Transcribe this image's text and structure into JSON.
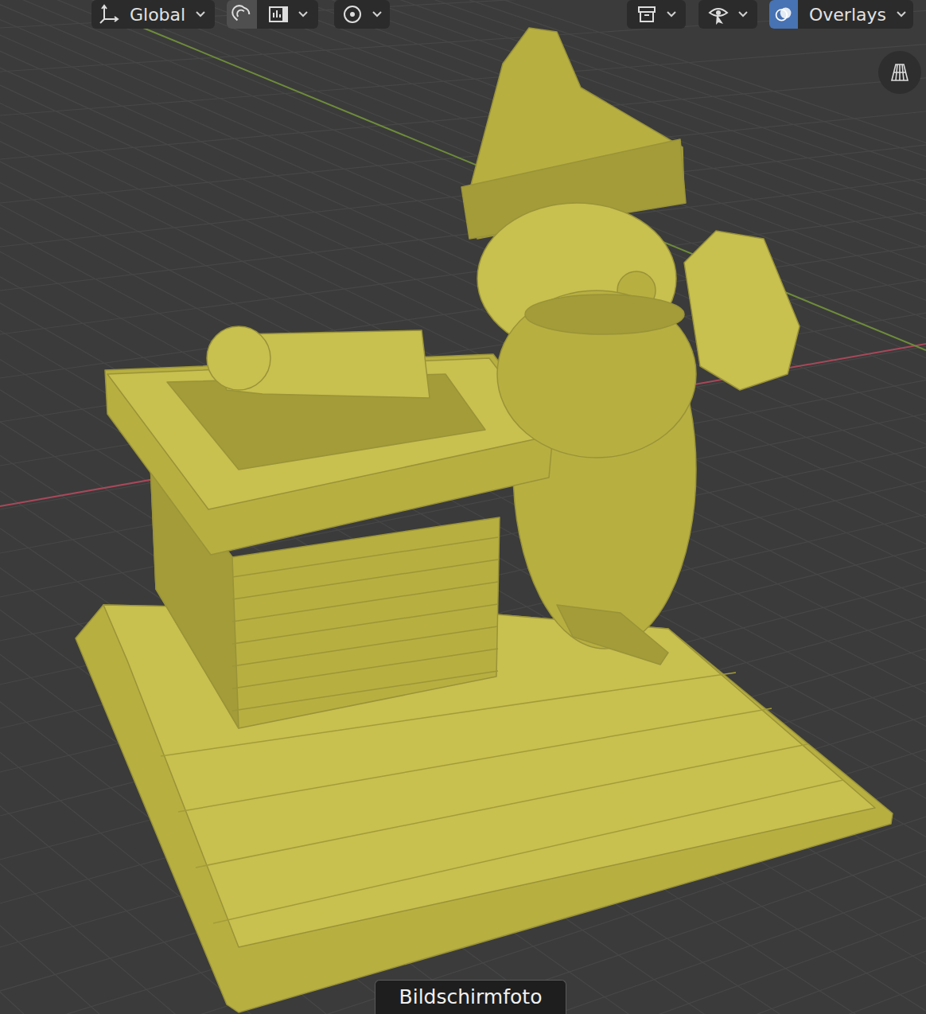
{
  "header": {
    "orientation": {
      "label": "Global"
    },
    "snap": {
      "on": true
    },
    "overlays": {
      "label": "Overlays",
      "on": true
    }
  },
  "tooltip": {
    "label": "Bildschirmfoto"
  }
}
